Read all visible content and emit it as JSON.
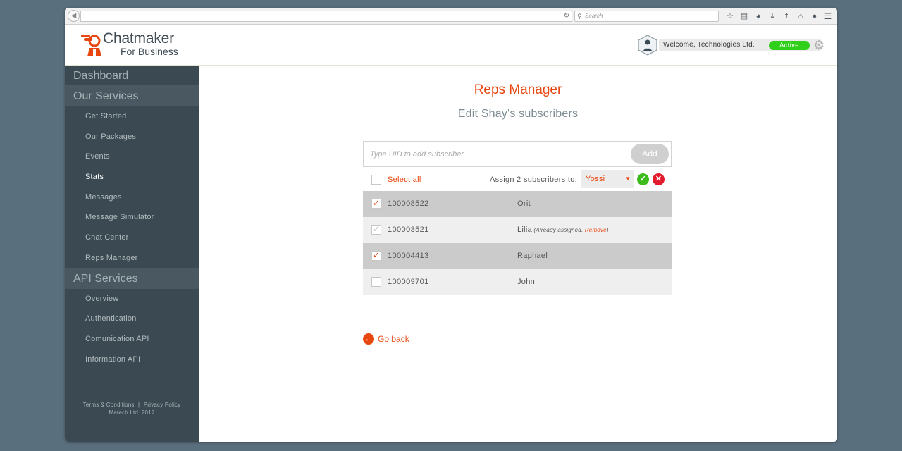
{
  "browser": {
    "search_placeholder": "Search",
    "toolbar_icons": [
      "star-icon",
      "reading-list-icon",
      "pocket-icon",
      "download-icon",
      "facebook-icon",
      "home-icon",
      "chat-icon"
    ]
  },
  "header": {
    "logo_line1": "Chatmaker",
    "logo_line2": "For Business",
    "welcome": "Welcome, Technologies Ltd.",
    "status": "Active"
  },
  "sidebar": {
    "dashboard": "Dashboard",
    "our_services": {
      "label": "Our Services",
      "items": [
        "Get Started",
        "Our Packages",
        "Events",
        "Stats",
        "Messages",
        "Message Simulator",
        "Chat Center",
        "Reps Manager"
      ]
    },
    "api_services": {
      "label": "API Services",
      "items": [
        "Overview",
        "Authentication",
        "Comunication API",
        "Information API"
      ]
    },
    "footer": {
      "terms": "Terms & Conditions",
      "separator": "|",
      "privacy": "Privacy Policy",
      "copyright": "Matech Ltd. 2017"
    }
  },
  "main": {
    "title": "Reps Manager",
    "subtitle": "Edit Shay's subscribers",
    "uid_placeholder": "Type UID to add subscriber",
    "add_label": "Add",
    "select_all": "Select all",
    "assign_label": "Assign 2 subscribers to:",
    "selected_rep": "Yossi",
    "go_back": "Go back",
    "subscribers": [
      {
        "uid": "100008522",
        "name": "Orit",
        "checked": true,
        "disabled": false,
        "note": "",
        "remove": ""
      },
      {
        "uid": "100003521",
        "name": "Lilia",
        "checked": true,
        "disabled": true,
        "note": "(Already assigned.",
        "remove": "Remove"
      },
      {
        "uid": "100004413",
        "name": "Raphael",
        "checked": true,
        "disabled": false,
        "note": "",
        "remove": ""
      },
      {
        "uid": "100009701",
        "name": "John",
        "checked": false,
        "disabled": false,
        "note": "",
        "remove": ""
      }
    ]
  },
  "colors": {
    "accent": "#e8460f",
    "sidebar_bg": "#3b4a52",
    "row_selected": "#cbcbcb",
    "row_alt": "#efefef",
    "status_green": "#2fcf1a",
    "confirm_green": "#3dbb1c",
    "cancel_red": "#e21b2d"
  }
}
